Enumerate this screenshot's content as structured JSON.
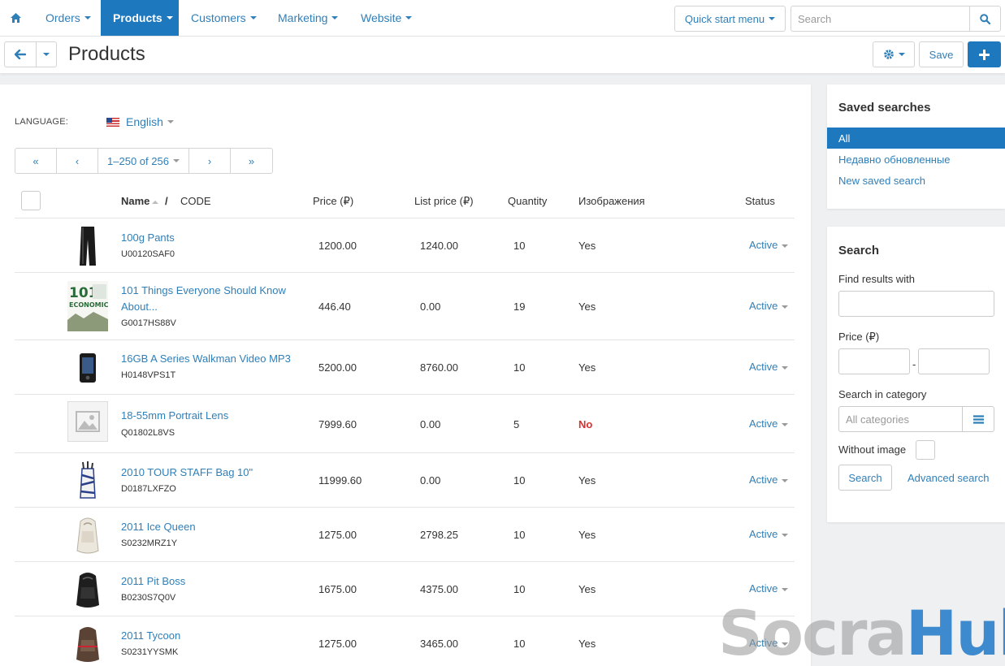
{
  "nav": {
    "items": [
      "Orders",
      "Products",
      "Customers",
      "Marketing",
      "Website"
    ],
    "active_index": 1,
    "quick_start": "Quick start menu",
    "search_placeholder": "Search"
  },
  "header": {
    "title": "Products",
    "save_label": "Save"
  },
  "language": {
    "label": "LANGUAGE:",
    "value": "English"
  },
  "pager": {
    "first": "«",
    "prev": "‹",
    "range": "1–250 of 256",
    "next": "›",
    "last": "»"
  },
  "table": {
    "columns": {
      "name": "Name",
      "code": "CODE",
      "price": "Price (₽)",
      "list_price": "List price (₽)",
      "quantity": "Quantity",
      "images": "Изображения",
      "status": "Status"
    },
    "rows": [
      {
        "name": "100g Pants",
        "code": "U00120SAF0",
        "price": "1200.00",
        "list_price": "1240.00",
        "quantity": "10",
        "images": "Yes",
        "status": "Active",
        "thumb": "pants-image"
      },
      {
        "name": "101 Things Everyone Should Know About...",
        "code": "G0017HS88V",
        "price": "446.40",
        "list_price": "0.00",
        "quantity": "19",
        "images": "Yes",
        "status": "Active",
        "thumb": "book-cover-image"
      },
      {
        "name": "16GB A Series Walkman Video MP3",
        "code": "H0148VPS1T",
        "price": "5200.00",
        "list_price": "8760.00",
        "quantity": "10",
        "images": "Yes",
        "status": "Active",
        "thumb": "mp3-player-image"
      },
      {
        "name": "18-55mm Portrait Lens",
        "code": "Q01802L8VS",
        "price": "7999.60",
        "list_price": "0.00",
        "quantity": "5",
        "images": "No",
        "status": "Active",
        "thumb": "placeholder-image"
      },
      {
        "name": "2010 TOUR STAFF Bag 10\"",
        "code": "D0187LXFZO",
        "price": "11999.60",
        "list_price": "0.00",
        "quantity": "10",
        "images": "Yes",
        "status": "Active",
        "thumb": "golf-bag-image"
      },
      {
        "name": "2011 Ice Queen",
        "code": "S0232MRZ1Y",
        "price": "1275.00",
        "list_price": "2798.25",
        "quantity": "10",
        "images": "Yes",
        "status": "Active",
        "thumb": "white-backpack-image"
      },
      {
        "name": "2011 Pit Boss",
        "code": "B0230S7Q0V",
        "price": "1675.00",
        "list_price": "4375.00",
        "quantity": "10",
        "images": "Yes",
        "status": "Active",
        "thumb": "black-backpack-image"
      },
      {
        "name": "2011 Tycoon",
        "code": "S0231YYSMK",
        "price": "1275.00",
        "list_price": "3465.00",
        "quantity": "10",
        "images": "Yes",
        "status": "Active",
        "thumb": "brown-backpack-image"
      }
    ]
  },
  "saved_searches": {
    "title": "Saved searches",
    "items": [
      "All",
      "Недавно обновленные",
      "New saved search"
    ]
  },
  "search_panel": {
    "title": "Search",
    "find_label": "Find results with",
    "price_label": "Price (₽)",
    "price_sep": "-",
    "category_label": "Search in category",
    "category_placeholder": "All categories",
    "without_image_label": "Without image",
    "search_button": "Search",
    "advanced_link": "Advanced search"
  },
  "watermark": {
    "part1": "Socra",
    "part2": "Hub"
  },
  "colors": {
    "accent": "#1e78bd",
    "link": "#2f7fb8",
    "no": "#d9302c"
  }
}
